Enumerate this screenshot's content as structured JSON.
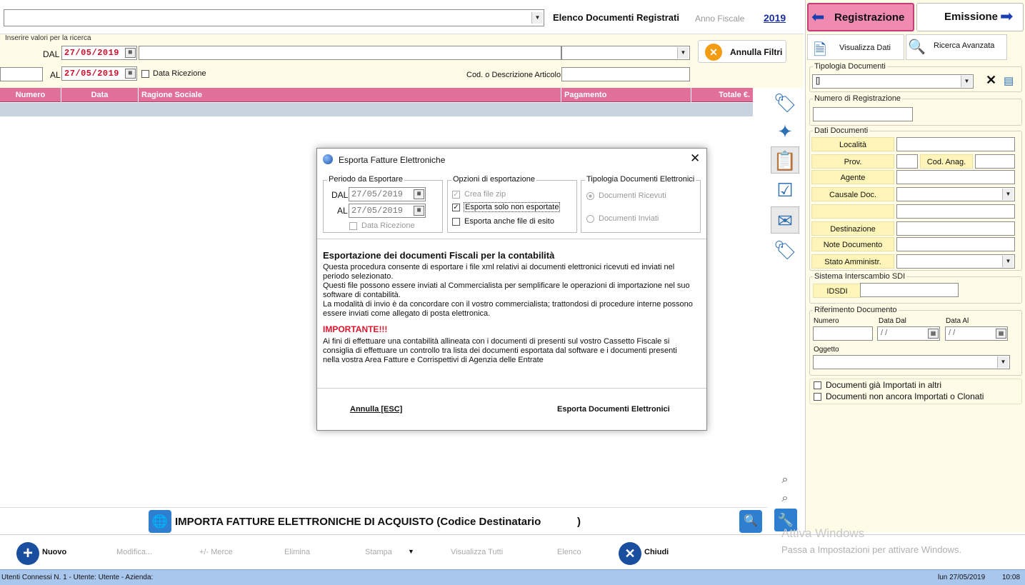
{
  "header": {
    "list_title": "Elenco Documenti Registrati",
    "fiscal_year_label": "Anno Fiscale",
    "fiscal_year": "2019",
    "registrazione_label": "Registrazione",
    "emissione_label": "Emissione"
  },
  "filters": {
    "group_title": "Inserire valori per la ricerca",
    "dal_label": "DAL",
    "dal_value": "27/05/2019",
    "al_label": "AL",
    "al_value": "27/05/2019",
    "data_ricezione_label": "Data Ricezione",
    "articolo_label": "Cod. o Descrizione Articolo",
    "annulla_filtri_label": "Annulla Filtri"
  },
  "grid": {
    "columns": [
      "Numero",
      "Data",
      "Ragione Sociale",
      "Pagamento",
      "Totale €."
    ]
  },
  "right_panel": {
    "visualizza_dati": "Visualizza Dati",
    "ricerca_avanzata": "Ricerca Avanzata",
    "tipologia_title": "Tipologia Documenti",
    "tipologia_value": "[]",
    "numero_reg_title": "Numero di Registrazione",
    "dati_documenti_title": "Dati Documenti",
    "localita": "Località",
    "prov": "Prov.",
    "cod_anag": "Cod. Anag.",
    "agente": "Agente",
    "causale": "Causale Doc.",
    "destinazione": "Destinazione",
    "note": "Note Documento",
    "stato": "Stato Amministr.",
    "sdi_title": "Sistema Interscambio SDI",
    "idsdi": "IDSDI",
    "rif_title": "Riferimento Documento",
    "rif_numero": "Numero",
    "rif_data_dal": "Data Dal",
    "rif_data_al": "Data Al",
    "rif_date_placeholder": " / /",
    "oggetto": "Oggetto",
    "chk_importati": "Documenti già Importati in altri",
    "chk_non_importati": "Documenti non ancora Importati o Clonati"
  },
  "import_bar": {
    "label": "IMPORTA FATTURE ELETTRONICHE DI ACQUISTO (Codice Destinatario",
    "close_paren": ")"
  },
  "bottom": {
    "nuovo": "Nuovo",
    "modifica": "Modifica...",
    "merce": "+/- Merce",
    "elimina": "Elimina",
    "stampa": "Stampa",
    "visualizza_tutti": "Visualizza Tutti",
    "elenco": "Elenco",
    "chiudi": "Chiudi"
  },
  "watermark": {
    "line1": "Attiva Windows",
    "line2": "Passa a Impostazioni per attivare Windows."
  },
  "status": {
    "left": "Utenti Connessi N. 1 - Utente: Utente - Azienda:",
    "date": "lun 27/05/2019",
    "time": "10:08"
  },
  "dialog": {
    "title": "Esporta Fatture Elettroniche",
    "periodo_title": "Periodo da Esportare",
    "dal_label": "DAL",
    "dal_value": "27/05/2019",
    "al_label": "AL",
    "al_value": "27/05/2019",
    "data_ricezione": "Data Ricezione",
    "opzioni_title": "Opzioni di esportazione",
    "crea_zip": "Crea file zip",
    "solo_non_esportate": "Esporta solo non esportate",
    "anche_esito": "Esporta anche file di esito",
    "tipologia_title": "Tipologia Documenti Elettronici",
    "ricevuti": "Documenti Ricevuti",
    "inviati": "Documenti Inviati",
    "heading": "Esportazione dei documenti Fiscali per la contabilità",
    "p1": "Questa procedura consente di esportare i file xml relativi ai documenti elettronici ricevuti ed inviati nel periodo selezionato.",
    "p2": "Questi file possono essere inviati al Commercialista per semplificare le operazioni di importazione nel suo software di contabilità.",
    "p3": "La modalità di invio è da concordare con il vostro commercialista; trattondosi di procedure interne possono essere inviati come allegato di posta elettronica.",
    "important": "IMPORTANTE!!!",
    "p4": "Ai fini di effettuare una contabilità allineata con i documenti di presenti sul vostro Cassetto Fiscale si consiglia di effettuare un controllo tra lista dei documenti esportata dal software e i documenti presenti nella vostra Area Fatture e Corrispettivi di Agenzia delle Entrate",
    "annulla": "Annulla [ESC]",
    "esporta": "Esporta Documenti Elettronici"
  }
}
